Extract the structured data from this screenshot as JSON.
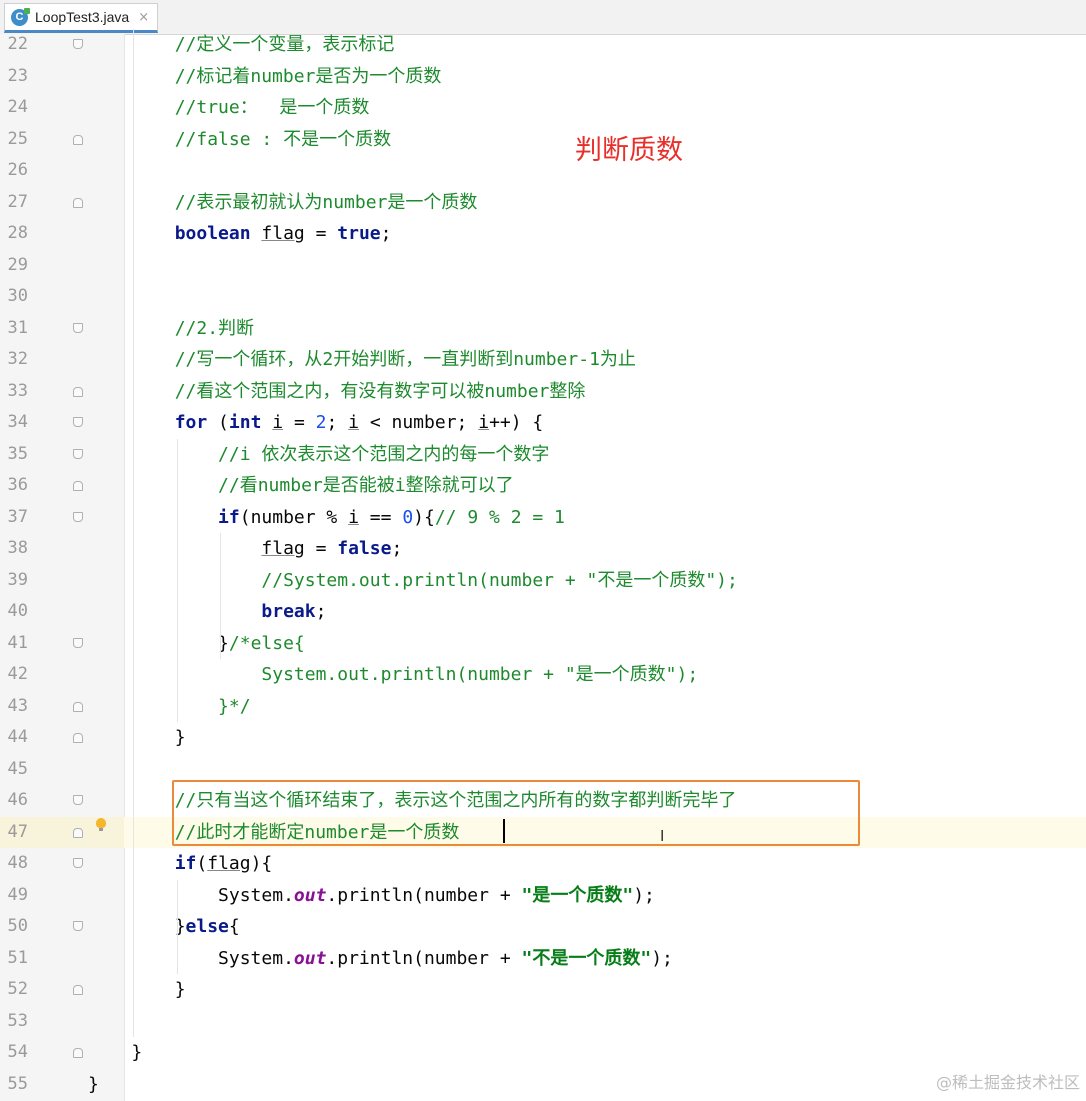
{
  "tab": {
    "title": "LoopTest3.java",
    "close": "×",
    "icon_letter": "C"
  },
  "annotation": "判断质数",
  "watermark": "@稀土掘金技术社区",
  "cursor_line": 47,
  "lines": [
    {
      "n": "22",
      "indent": 0,
      "fold": "open",
      "segs": [
        {
          "t": "        //定义一个变量，表示标记",
          "c": "c"
        }
      ]
    },
    {
      "n": "23",
      "indent": 0,
      "segs": [
        {
          "t": "        //标记着number是否为一个质数",
          "c": "c"
        }
      ]
    },
    {
      "n": "24",
      "indent": 0,
      "segs": [
        {
          "t": "        //true：  是一个质数",
          "c": "c"
        }
      ]
    },
    {
      "n": "25",
      "indent": 0,
      "fold": "close",
      "segs": [
        {
          "t": "        //false : 不是一个质数",
          "c": "c"
        }
      ]
    },
    {
      "n": "26",
      "segs": []
    },
    {
      "n": "27",
      "fold": "close",
      "segs": [
        {
          "t": "        //表示最初就认为number是一个质数",
          "c": "c"
        }
      ]
    },
    {
      "n": "28",
      "segs": [
        {
          "t": "        "
        },
        {
          "t": "boolean",
          "c": "k"
        },
        {
          "t": " "
        },
        {
          "t": "flag",
          "c": "u"
        },
        {
          "t": " = "
        },
        {
          "t": "true",
          "c": "k"
        },
        {
          "t": ";"
        }
      ]
    },
    {
      "n": "29",
      "segs": []
    },
    {
      "n": "30",
      "segs": []
    },
    {
      "n": "31",
      "fold": "open",
      "segs": [
        {
          "t": "        //2.判断",
          "c": "c"
        }
      ]
    },
    {
      "n": "32",
      "segs": [
        {
          "t": "        //写一个循环，从2开始判断，一直判断到number-1为止",
          "c": "c"
        }
      ]
    },
    {
      "n": "33",
      "fold": "close",
      "segs": [
        {
          "t": "        //看这个范围之内，有没有数字可以被number整除",
          "c": "c"
        }
      ]
    },
    {
      "n": "34",
      "fold": "open",
      "segs": [
        {
          "t": "        "
        },
        {
          "t": "for",
          "c": "k"
        },
        {
          "t": " ("
        },
        {
          "t": "int",
          "c": "k"
        },
        {
          "t": " "
        },
        {
          "t": "i",
          "c": "u"
        },
        {
          "t": " = "
        },
        {
          "t": "2",
          "c": "n"
        },
        {
          "t": "; "
        },
        {
          "t": "i",
          "c": "u"
        },
        {
          "t": " < number; "
        },
        {
          "t": "i",
          "c": "u"
        },
        {
          "t": "++) {"
        }
      ]
    },
    {
      "n": "35",
      "fold": "open",
      "segs": [
        {
          "t": "            //i 依次表示这个范围之内的每一个数字",
          "c": "c"
        }
      ]
    },
    {
      "n": "36",
      "fold": "close",
      "segs": [
        {
          "t": "            //看number是否能被i整除就可以了",
          "c": "c"
        }
      ]
    },
    {
      "n": "37",
      "fold": "open",
      "segs": [
        {
          "t": "            "
        },
        {
          "t": "if",
          "c": "k"
        },
        {
          "t": "(number % "
        },
        {
          "t": "i",
          "c": "u"
        },
        {
          "t": " == "
        },
        {
          "t": "0",
          "c": "n"
        },
        {
          "t": "){"
        },
        {
          "t": "// 9 % 2 = 1",
          "c": "c"
        }
      ]
    },
    {
      "n": "38",
      "segs": [
        {
          "t": "                "
        },
        {
          "t": "flag",
          "c": "u"
        },
        {
          "t": " = "
        },
        {
          "t": "false",
          "c": "k"
        },
        {
          "t": ";"
        }
      ]
    },
    {
      "n": "39",
      "segs": [
        {
          "t": "                //System.out.println(number + \"不是一个质数\");",
          "c": "c"
        }
      ]
    },
    {
      "n": "40",
      "segs": [
        {
          "t": "                "
        },
        {
          "t": "break",
          "c": "k"
        },
        {
          "t": ";"
        }
      ]
    },
    {
      "n": "41",
      "fold": "open",
      "segs": [
        {
          "t": "            }"
        },
        {
          "t": "/*else{",
          "c": "c"
        }
      ]
    },
    {
      "n": "42",
      "segs": [
        {
          "t": "                System.out.println(number + \"是一个质数\");",
          "c": "c"
        }
      ]
    },
    {
      "n": "43",
      "fold": "close",
      "segs": [
        {
          "t": "            }*/",
          "c": "c"
        }
      ]
    },
    {
      "n": "44",
      "fold": "close",
      "segs": [
        {
          "t": "        }"
        }
      ]
    },
    {
      "n": "45",
      "segs": []
    },
    {
      "n": "46",
      "fold": "open",
      "segs": [
        {
          "t": "        //只有当这个循环结束了，表示这个范围之内所有的数字都判断完毕了",
          "c": "c"
        }
      ]
    },
    {
      "n": "47",
      "fold": "close",
      "segs": [
        {
          "t": "        //此时才能断定number是一个质数",
          "c": "c"
        }
      ]
    },
    {
      "n": "48",
      "fold": "open",
      "segs": [
        {
          "t": "        "
        },
        {
          "t": "if",
          "c": "k"
        },
        {
          "t": "("
        },
        {
          "t": "flag",
          "c": "u"
        },
        {
          "t": "){"
        }
      ]
    },
    {
      "n": "49",
      "segs": [
        {
          "t": "            System."
        },
        {
          "t": "out",
          "c": "f"
        },
        {
          "t": ".println(number + "
        },
        {
          "t": "\"是一个质数\"",
          "c": "s"
        },
        {
          "t": ");"
        }
      ]
    },
    {
      "n": "50",
      "fold": "open",
      "segs": [
        {
          "t": "        }"
        },
        {
          "t": "else",
          "c": "k"
        },
        {
          "t": "{"
        }
      ]
    },
    {
      "n": "51",
      "segs": [
        {
          "t": "            System."
        },
        {
          "t": "out",
          "c": "f"
        },
        {
          "t": ".println(number + "
        },
        {
          "t": "\"不是一个质数\"",
          "c": "s"
        },
        {
          "t": ");"
        }
      ]
    },
    {
      "n": "52",
      "fold": "close",
      "segs": [
        {
          "t": "        }"
        }
      ]
    },
    {
      "n": "53",
      "segs": []
    },
    {
      "n": "54",
      "fold": "close",
      "segs": [
        {
          "t": "    }"
        }
      ]
    },
    {
      "n": "55",
      "segs": [
        {
          "t": "}"
        }
      ]
    }
  ]
}
